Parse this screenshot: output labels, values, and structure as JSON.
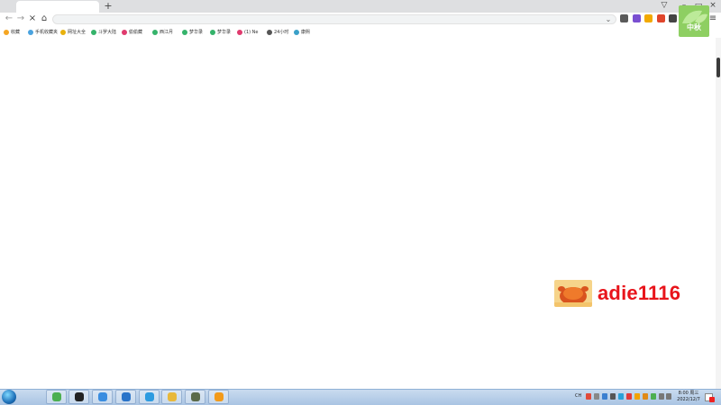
{
  "browser": {
    "new_tab_label": "+",
    "window_controls": {
      "shield": "▽",
      "minimize": "–",
      "maximize": "▭",
      "close": "×"
    },
    "nav": {
      "back": "←",
      "forward": "→",
      "stop": "×",
      "home": "⌂",
      "menu": "≡",
      "address_dropdown": "⌄"
    }
  },
  "bookmarks": [
    {
      "label": "收藏",
      "icon_color": "#f5a623"
    },
    {
      "label": "手机收藏夹",
      "icon_color": "#4aa3df"
    },
    {
      "label": "网址大全",
      "icon_color": "#e8b10c"
    },
    {
      "label": "斗罗大陆",
      "icon_color": "#35b36b"
    },
    {
      "label": "偷偷藏",
      "icon_color": "#e03a6e"
    },
    {
      "label": "西江月",
      "icon_color": "#35b36b"
    },
    {
      "label": "梦华录",
      "icon_color": "#35b36b"
    },
    {
      "label": "梦华录",
      "icon_color": "#35b36b"
    },
    {
      "label": "(1) Ne",
      "icon_color": "#e03a6e"
    },
    {
      "label": "24小时",
      "icon_color": "#555555"
    },
    {
      "label": "康熙",
      "icon_color": "#3aa0c8"
    }
  ],
  "avatar": {
    "label": "中秋"
  },
  "watermark": {
    "text": "adie1116"
  },
  "taskbar": {
    "apps": [
      {
        "name": "browser",
        "color": "#4caf50"
      },
      {
        "name": "media",
        "color": "#222222"
      },
      {
        "name": "cloud",
        "color": "#3a8de0"
      },
      {
        "name": "feather",
        "color": "#2a74c9"
      },
      {
        "name": "chat",
        "color": "#2d9be0"
      },
      {
        "name": "glasses",
        "color": "#e8b83a"
      },
      {
        "name": "robot",
        "color": "#5b6b4a"
      },
      {
        "name": "help",
        "color": "#f29a1a"
      }
    ],
    "tray_lang": "CH",
    "clock_time": "8:00 周三",
    "clock_date": "2022/12/7"
  }
}
